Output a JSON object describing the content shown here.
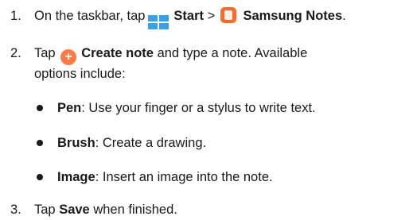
{
  "steps": [
    {
      "number": "1.",
      "parts": {
        "prefix": "On the taskbar, tap",
        "start": "Start",
        "sep": ">",
        "app": "Samsung Notes",
        "suffix": "."
      },
      "icons": [
        "windows-start-icon",
        "samsung-notes-icon"
      ]
    },
    {
      "number": "2.",
      "parts": {
        "prefix": "Tap",
        "create": "Create note",
        "suffix_line1": "and type a note. Available",
        "line2": "options include:"
      },
      "icons": [
        "plus-icon"
      ],
      "options": [
        {
          "term": "Pen",
          "desc": ": Use your finger or a stylus to write text."
        },
        {
          "term": "Brush",
          "desc": ": Create a drawing."
        },
        {
          "term": "Image",
          "desc": ": Insert an image into the note."
        }
      ]
    },
    {
      "number": "3.",
      "parts": {
        "prefix": "Tap",
        "save": "Save",
        "suffix": "when finished."
      }
    }
  ],
  "colors": {
    "text": "#1a1a1a",
    "windows_icon": "#3aa0e8",
    "notes_icon": "#ff6a2b",
    "plus_icon": "#ff7a45"
  }
}
